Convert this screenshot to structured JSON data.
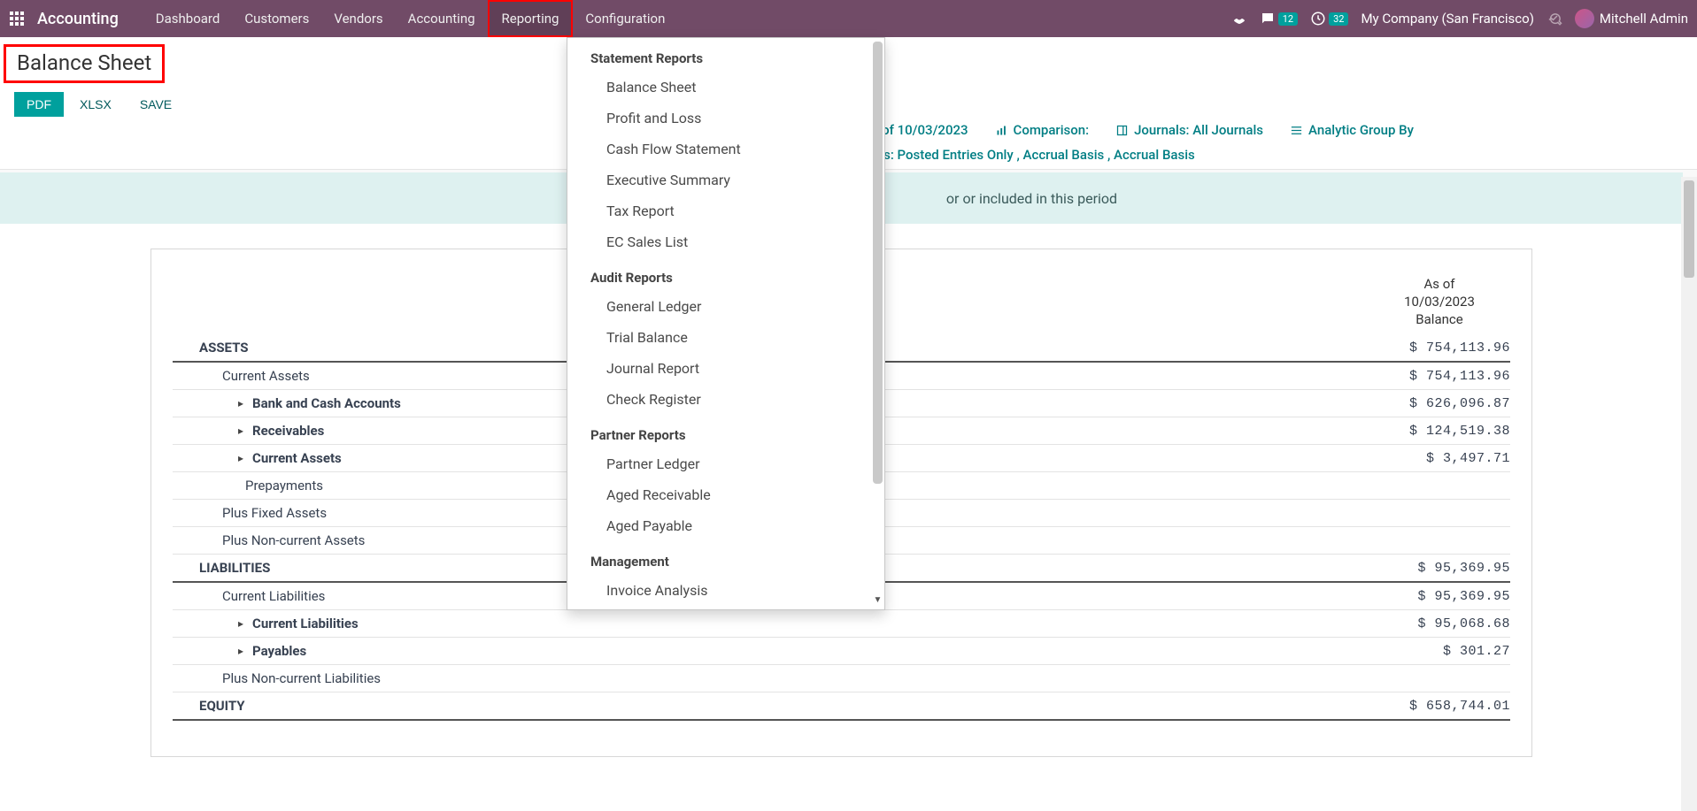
{
  "navbar": {
    "brand": "Accounting",
    "menu": [
      "Dashboard",
      "Customers",
      "Vendors",
      "Accounting",
      "Reporting",
      "Configuration"
    ],
    "active_index": 4,
    "messages_badge": "12",
    "activities_badge": "32",
    "company": "My Company (San Francisco)",
    "user": "Mitchell Admin"
  },
  "page": {
    "title": "Balance Sheet",
    "buttons": {
      "pdf": "PDF",
      "xlsx": "XLSX",
      "save": "SAVE"
    },
    "filters": {
      "as_of_prefix": "As of ",
      "as_of_date": "10/03/2023",
      "comparison": "Comparison:",
      "journals_prefix": "Journals: ",
      "journals_value": "All Journals",
      "analytic": "Analytic Group By",
      "options_prefix": "Options: ",
      "options_value": "Posted Entries Only , Accrual Basis , Accrual Basis"
    },
    "banner_partial": "or or included in this period"
  },
  "dropdown": {
    "groups": [
      {
        "title": "Statement Reports",
        "items": [
          "Balance Sheet",
          "Profit and Loss",
          "Cash Flow Statement",
          "Executive Summary",
          "Tax Report",
          "EC Sales List"
        ]
      },
      {
        "title": "Audit Reports",
        "items": [
          "General Ledger",
          "Trial Balance",
          "Journal Report",
          "Check Register"
        ]
      },
      {
        "title": "Partner Reports",
        "items": [
          "Partner Ledger",
          "Aged Receivable",
          "Aged Payable"
        ]
      },
      {
        "title": "Management",
        "items": [
          "Invoice Analysis"
        ]
      }
    ]
  },
  "report": {
    "col_header_line1": "As of",
    "col_header_line2": "10/03/2023",
    "col_header_line3": "Balance",
    "rows": [
      {
        "label": "ASSETS",
        "amount": "$ 754,113.96",
        "indent": 0,
        "section": true,
        "caret": false
      },
      {
        "label": "Current Assets",
        "amount": "$ 754,113.96",
        "indent": 1,
        "caret": false,
        "plain": true
      },
      {
        "label": "Bank and Cash Accounts",
        "amount": "$ 626,096.87",
        "indent": 2,
        "caret": true
      },
      {
        "label": "Receivables",
        "amount": "$ 124,519.38",
        "indent": 2,
        "caret": true
      },
      {
        "label": "Current Assets",
        "amount": "$ 3,497.71",
        "indent": 2,
        "caret": true
      },
      {
        "label": "Prepayments",
        "amount": "",
        "indent": 2,
        "caret": false,
        "plain": true
      },
      {
        "label": "Plus Fixed Assets",
        "amount": "",
        "indent": 1,
        "caret": false,
        "plain": true
      },
      {
        "label": "Plus Non-current Assets",
        "amount": "",
        "indent": 1,
        "caret": false,
        "plain": true
      },
      {
        "label": "LIABILITIES",
        "amount": "$ 95,369.95",
        "indent": 0,
        "section": true,
        "caret": false
      },
      {
        "label": "Current Liabilities",
        "amount": "$ 95,369.95",
        "indent": 1,
        "caret": false,
        "plain": true
      },
      {
        "label": "Current Liabilities",
        "amount": "$ 95,068.68",
        "indent": 2,
        "caret": true
      },
      {
        "label": "Payables",
        "amount": "$ 301.27",
        "indent": 2,
        "caret": true
      },
      {
        "label": "Plus Non-current Liabilities",
        "amount": "",
        "indent": 1,
        "caret": false,
        "plain": true
      },
      {
        "label": "EQUITY",
        "amount": "$ 658,744.01",
        "indent": 0,
        "section": true,
        "caret": false
      }
    ]
  }
}
